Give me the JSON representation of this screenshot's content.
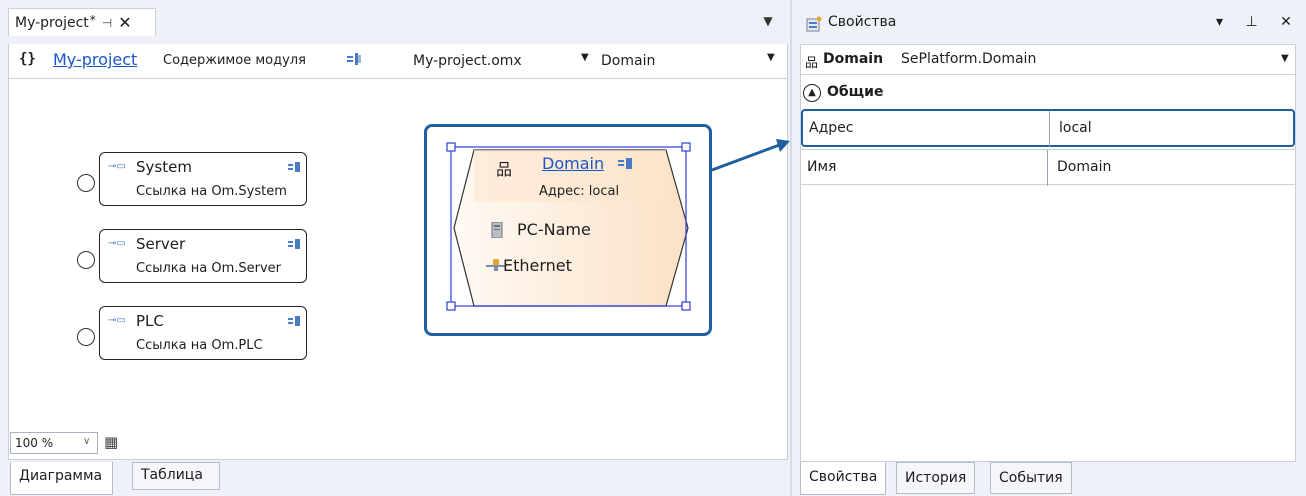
{
  "document_tab": {
    "title": "My-project",
    "modified_mark": "*",
    "pin_glyph": "⊣",
    "close_glyph": "✕"
  },
  "left_menu_glyph": "▼",
  "toolbar": {
    "braces": "{}",
    "project_link": "My-project",
    "module_label": "Содержимое модуля",
    "file_combo": "My-project.omx",
    "domain_combo": "Domain"
  },
  "references": [
    {
      "name": "System",
      "description": "Ссылка на Om.System"
    },
    {
      "name": "Server",
      "description": "Ссылка на Om.Server"
    },
    {
      "name": "PLC",
      "description": "Ссылка на Om.PLC"
    }
  ],
  "domain_node": {
    "name": "Domain",
    "address": "Адрес: local",
    "items": [
      "PC-Name",
      "Ethernet"
    ]
  },
  "zoom": {
    "value": "100 %"
  },
  "bottom_tabs": [
    "Диаграмма",
    "Таблица"
  ],
  "properties": {
    "title": "Свойства",
    "controls": "▾ ⊥ ✕",
    "object_name": "Domain",
    "object_type": "SePlatform.Domain",
    "category": "Общие",
    "rows": [
      {
        "key": "Адрес",
        "value": "local"
      },
      {
        "key": "Имя",
        "value": "Domain"
      }
    ],
    "tabs": [
      "Свойства",
      "История",
      "События"
    ]
  },
  "colors": {
    "accent": "#1f5f9e",
    "link": "#1a55c8",
    "node_fill": "#fde8d2",
    "selection": "#2b3fd6"
  }
}
